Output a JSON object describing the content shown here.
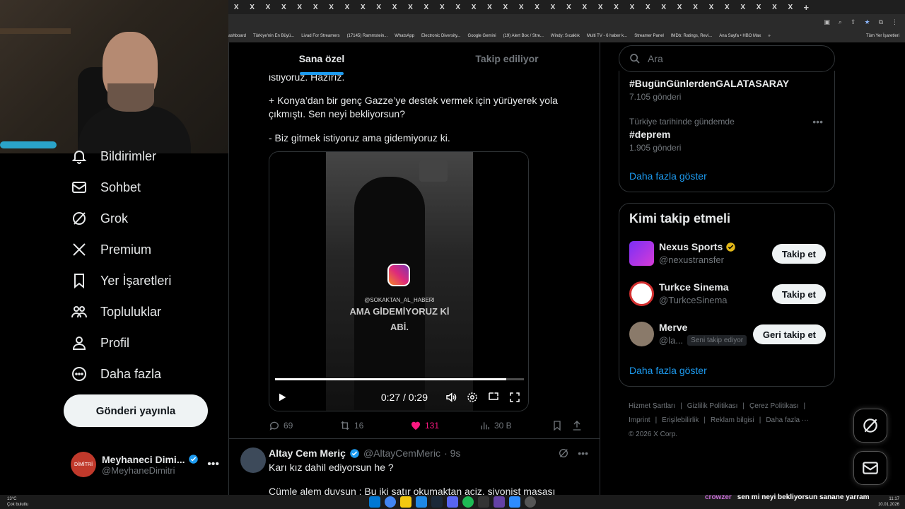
{
  "browser": {
    "tab_glyph": "X",
    "tab_count": 36,
    "new_tab": "+",
    "bookmarks": [
      "ashboard",
      "Türkiye'nin En Büyü...",
      "Livad For Streamers",
      "(17145) Rammstein...",
      "WhatsApp",
      "Electronic Diversity...",
      "Google Gemini",
      "(19) Alert Box / Stre...",
      "Windy: Sıcaklık",
      "Multi TV - 6 haber k...",
      "Streamer Panel",
      "IMDb: Ratings, Revi...",
      "Ana Sayfa • HBO Max",
      "»",
      "Tüm Yer İşaretleri"
    ]
  },
  "nav": {
    "items": [
      {
        "label": "Bildirimler",
        "icon": "bell-icon"
      },
      {
        "label": "Sohbet",
        "icon": "mail-icon"
      },
      {
        "label": "Grok",
        "icon": "grok-icon"
      },
      {
        "label": "Premium",
        "icon": "x-logo-icon"
      },
      {
        "label": "Yer İşaretleri",
        "icon": "bookmark-icon"
      },
      {
        "label": "Topluluklar",
        "icon": "people-icon"
      },
      {
        "label": "Profil",
        "icon": "person-icon"
      },
      {
        "label": "Daha fazla",
        "icon": "more-circle-icon"
      }
    ],
    "post_button": "Gönderi yayınla",
    "profile": {
      "name": "Meyhaneci Dimi...",
      "handle": "@MeyhaneDimitri",
      "avatar_text": "DİMİTRİ",
      "more": "•••"
    }
  },
  "timeline": {
    "tabs": [
      {
        "label": "Sana özel",
        "active": true
      },
      {
        "label": "Takip ediliyor",
        "active": false
      }
    ],
    "tweet1": {
      "text_top": "istiyoruz. Hazırız.",
      "text_p1": "+ Konya’dan bir genç Gazze’ye destek vermek için yürüyerek yola çıkmıştı. Sen neyi bekliyorsun?",
      "text_p2": "- Biz gitmek istiyoruz ama gidemiyoruz ki.",
      "video": {
        "watermark": "@SOKAKTAN_AL_HABERI",
        "caption_line1": "AMA GİDEMİYORUZ Kİ",
        "caption_line2": "ABİ.",
        "time": "0:27 / 0:29",
        "progress": 0.93
      },
      "replies": "69",
      "reposts": "16",
      "likes": "131",
      "views": "30 B"
    },
    "tweet2": {
      "name": "Altay Cem Meriç",
      "handle": "@AltayCemMeric",
      "time": "· 9s",
      "text1": "Karı kız dahil ediyorsun he ?",
      "text2": "Cümle alem duysun ; Bu iki satır okumaktan aciz, siyonist masası"
    }
  },
  "sidebar": {
    "search_placeholder": "Ara",
    "trends": [
      {
        "context": "",
        "tag": "#BugünGünlerdenGALATASARAY",
        "count": "7.105 gönderi"
      },
      {
        "context": "Türkiye tarihinde gündemde",
        "tag": "#deprem",
        "count": "1.905 gönderi"
      }
    ],
    "trends_more": "Daha fazla göster",
    "who_to_follow": {
      "title": "Kimi takip etmeli",
      "users": [
        {
          "name": "Nexus Sports",
          "handle": "@nexustransfer",
          "button": "Takip et",
          "verified_color": "#e2b719",
          "avatar_color": "#7b2ff7"
        },
        {
          "name": "Turkce Sinema",
          "handle": "@TurkceSinema",
          "button": "Takip et",
          "verified_color": "",
          "avatar_color": "#ffffff"
        },
        {
          "name": "Merve",
          "handle": "@la...",
          "badge": "Seni takip ediyor",
          "button": "Geri takip et",
          "verified_color": "",
          "avatar_color": "#8a7a6a"
        }
      ],
      "more": "Daha fazla göster"
    },
    "footer": [
      "Hizmet Şartları",
      "|",
      "Gizlilik Politikası",
      "|",
      "Çerez Politikası",
      "|",
      "Imprint",
      "|",
      "Erişilebilirlik",
      "|",
      "Reklam bilgisi",
      "|",
      "Daha fazla ···",
      "© 2026 X Corp."
    ]
  },
  "taskbar": {
    "weather_temp": "13°C",
    "weather_desc": "Çok bulutlu",
    "time": "11:17",
    "date": "10.01.2026",
    "chat_user": "crowzer",
    "chat_message": "sen mi neyi bekliyorsun sanane yarram"
  },
  "colors": {
    "accent": "#1d9bf0",
    "like": "#f91880",
    "verified": "#1d9bf0"
  }
}
